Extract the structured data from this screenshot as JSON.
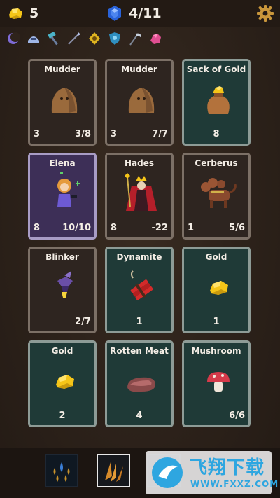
{
  "header": {
    "gold_count": "5",
    "gems_progress": "4/11"
  },
  "inventory_icons": [
    "moon-icon",
    "helmet-icon",
    "hammer-icon",
    "spear-icon",
    "amulet-icon",
    "shield-icon",
    "scythe-icon",
    "pink-crystal-icon"
  ],
  "cards": [
    {
      "title": "Mudder",
      "left": "3",
      "right": "3/8",
      "style": "dark",
      "art": "mudder"
    },
    {
      "title": "Mudder",
      "left": "3",
      "right": "7/7",
      "style": "dark",
      "art": "mudder"
    },
    {
      "title": "Sack of Gold",
      "center": "8",
      "style": "teal",
      "art": "sack"
    },
    {
      "title": "Elena",
      "left": "8",
      "right": "10/10",
      "style": "purple",
      "art": "elena"
    },
    {
      "title": "Hades",
      "left": "8",
      "right": "-22",
      "style": "dark",
      "art": "hades"
    },
    {
      "title": "Cerberus",
      "left": "1",
      "right": "5/6",
      "style": "dark",
      "art": "cerberus"
    },
    {
      "title": "Blinker",
      "right": "2/7",
      "style": "dark",
      "art": "blinker"
    },
    {
      "title": "Dynamite",
      "center": "1",
      "style": "teal",
      "art": "dynamite"
    },
    {
      "title": "Gold",
      "center": "1",
      "style": "teal",
      "art": "gold"
    },
    {
      "title": "Gold",
      "center": "2",
      "style": "teal",
      "art": "gold"
    },
    {
      "title": "Rotten Meat",
      "center": "4",
      "style": "teal",
      "art": "meat"
    },
    {
      "title": "Mushroom",
      "right": "6/6",
      "style": "teal",
      "art": "mushroom"
    }
  ],
  "toolbar": {
    "tools": [
      "water-drops-icon",
      "claw-slash-icon"
    ]
  },
  "watermark": {
    "text": "飞翔下载",
    "url": "WWW.FXXZ.COM"
  },
  "colors": {
    "teal_card": "#1f3a37",
    "purple_card": "#3d2f57",
    "dark_card": "#2e2520",
    "gold": "#f5c518",
    "gem_blue": "#2a63d9"
  }
}
